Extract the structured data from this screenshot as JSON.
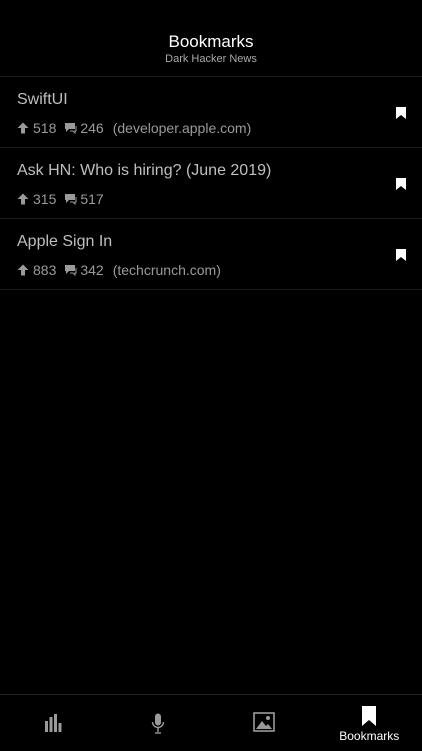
{
  "header": {
    "title": "Bookmarks",
    "subtitle": "Dark Hacker News"
  },
  "stories": [
    {
      "title": "SwiftUI",
      "points": "518",
      "comments": "246",
      "domain": "(developer.apple.com)"
    },
    {
      "title": "Ask HN: Who is hiring? (June 2019)",
      "points": "315",
      "comments": "517",
      "domain": ""
    },
    {
      "title": "Apple Sign In",
      "points": "883",
      "comments": "342",
      "domain": "(techcrunch.com)"
    }
  ],
  "tabs": [
    {
      "icon": "bar-chart-icon",
      "label": ""
    },
    {
      "icon": "microphone-icon",
      "label": ""
    },
    {
      "icon": "image-icon",
      "label": ""
    },
    {
      "icon": "bookmark-icon",
      "label": "Bookmarks",
      "active": true
    }
  ],
  "colors": {
    "background": "#000000",
    "title_text": "#ffffff",
    "story_title": "#bfbfbf",
    "meta_text": "#9a9a9a",
    "inactive_tab_icon": "#9a9a9a",
    "active_tab_icon": "#ffffff"
  }
}
